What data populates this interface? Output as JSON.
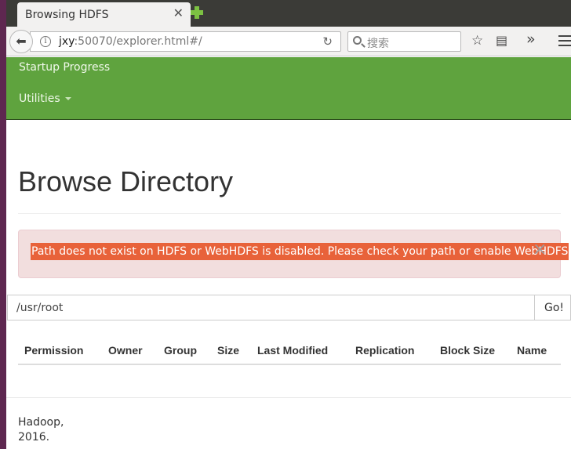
{
  "browser": {
    "tab_title": "Browsing HDFS",
    "url_host": "jxy",
    "url_rest": ":50070/explorer.html#/",
    "search_placeholder": "搜索"
  },
  "header": {
    "nav_items": [
      {
        "label": "Startup Progress"
      },
      {
        "label": "Utilities"
      }
    ]
  },
  "main": {
    "title": "Browse Directory",
    "alert": "Path does not exist on HDFS or WebHDFS is disabled. Please check your path or enable WebHDFS",
    "path_value": "/usr/root",
    "go_label": "Go!",
    "columns": [
      "Permission",
      "Owner",
      "Group",
      "Size",
      "Last Modified",
      "Replication",
      "Block Size",
      "Name"
    ]
  },
  "footer": {
    "line1": "Hadoop,",
    "line2": "2016."
  },
  "colors": {
    "header_green": "#5fa33e",
    "alert_bg": "#f2dede",
    "alert_highlight": "#e8623a"
  }
}
